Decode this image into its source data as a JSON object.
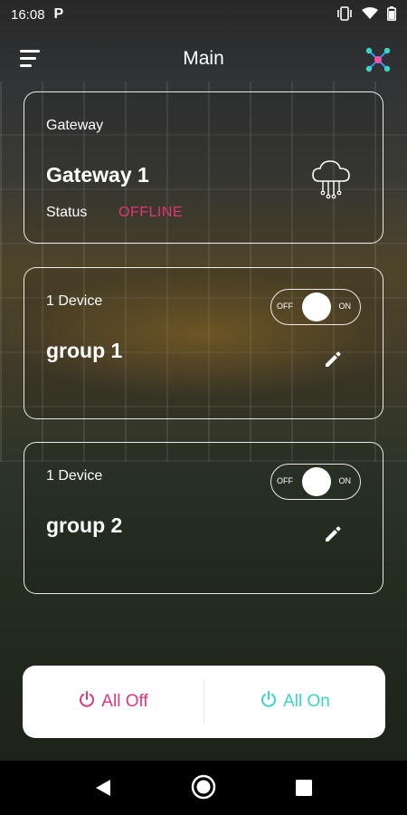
{
  "status_bar": {
    "time": "16:08",
    "notification_icon": "p-icon",
    "icons": [
      "vibrate-icon",
      "wifi-icon",
      "battery-icon"
    ]
  },
  "app_bar": {
    "title": "Main",
    "menu_icon": "menu-icon",
    "network_icon": "network-icon"
  },
  "gateway": {
    "label": "Gateway",
    "name": "Gateway 1",
    "status_label": "Status",
    "status_value": "OFFLINE",
    "icon": "cloud-chip-icon"
  },
  "groups": [
    {
      "device_count": "1 Device",
      "name": "group 1",
      "toggle_off": "OFF",
      "toggle_on": "ON"
    },
    {
      "device_count": "1 Device",
      "name": "group 2",
      "toggle_off": "OFF",
      "toggle_on": "ON"
    }
  ],
  "actions": {
    "all_off": "All Off",
    "all_on": "All On"
  },
  "colors": {
    "offline": "#e0367a",
    "all_off": "#e0367a",
    "all_on": "#36d6c6"
  }
}
